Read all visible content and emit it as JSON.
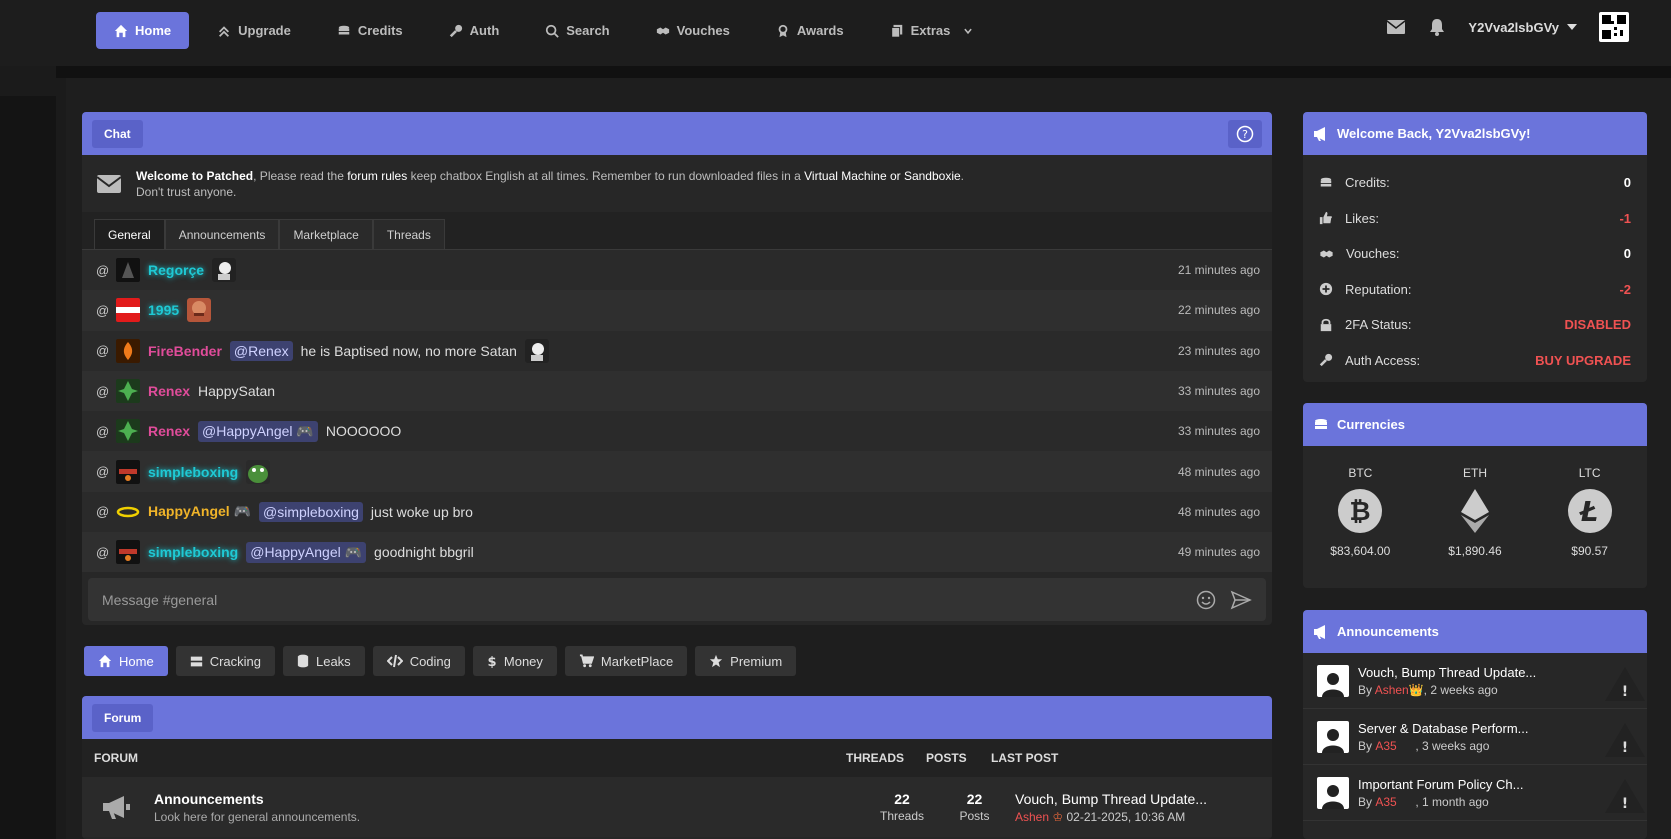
{
  "nav": {
    "items": [
      {
        "label": "Home",
        "icon": "home-icon"
      },
      {
        "label": "Upgrade",
        "icon": "upgrade-icon"
      },
      {
        "label": "Credits",
        "icon": "coins-icon"
      },
      {
        "label": "Auth",
        "icon": "key-icon"
      },
      {
        "label": "Search",
        "icon": "search-icon"
      },
      {
        "label": "Vouches",
        "icon": "handshake-icon"
      },
      {
        "label": "Awards",
        "icon": "award-icon"
      },
      {
        "label": "Extras",
        "icon": "copy-icon"
      }
    ],
    "username": "Y2Vva2lsbGVy"
  },
  "chat": {
    "title": "Chat",
    "notice_welcome": "Welcome to Patched",
    "notice_part1": ", Please read the ",
    "notice_rules": "forum rules",
    "notice_part2": " keep chatbox English at all times. Remember to run downloaded files in a ",
    "notice_vm": "Virtual Machine or Sandboxie",
    "notice_part3": ".",
    "notice_line2": "Don't trust anyone.",
    "tabs": [
      "General",
      "Announcements",
      "Marketplace",
      "Threads"
    ],
    "messages": [
      {
        "user": "Regorçe",
        "text": "",
        "mention": "",
        "time": "21 minutes ago"
      },
      {
        "user": "1995",
        "text": "",
        "mention": "",
        "time": "22 minutes ago"
      },
      {
        "user": "FireBender",
        "mention": "@Renex",
        "text": "he is Baptised now, no more Satan",
        "time": "23 minutes ago"
      },
      {
        "user": "Renex",
        "mention": "",
        "text": "HappySatan",
        "time": "33 minutes ago"
      },
      {
        "user": "Renex",
        "mention": "@HappyAngel 🎮",
        "text": "NOOOOOO",
        "time": "33 minutes ago"
      },
      {
        "user": "simpleboxing",
        "mention": "",
        "text": "",
        "time": "48 minutes ago"
      },
      {
        "user": "HappyAngel 🎮",
        "mention": "@simpleboxing",
        "text": "just woke up bro",
        "time": "48 minutes ago"
      },
      {
        "user": "simpleboxing",
        "mention": "@HappyAngel 🎮",
        "text": "goodnight bbgril",
        "time": "49 minutes ago"
      }
    ],
    "input_placeholder": "Message #general"
  },
  "categories": [
    "Home",
    "Cracking",
    "Leaks",
    "Coding",
    "Money",
    "MarketPlace",
    "Premium"
  ],
  "forum": {
    "title": "Forum",
    "columns": {
      "forum": "FORUM",
      "threads": "THREADS",
      "posts": "POSTS",
      "last_post": "LAST POST"
    },
    "rows": [
      {
        "title": "Announcements",
        "desc": "Look here for general announcements.",
        "threads": "22",
        "threads_label": "Threads",
        "posts": "22",
        "posts_label": "Posts",
        "last_title": "Vouch, Bump Thread Update...",
        "last_user": "Ashen",
        "last_date": "02-21-2025, 10:36 AM"
      }
    ]
  },
  "welcome": {
    "title": "Welcome Back, Y2Vva2lsbGVy!",
    "rows": [
      {
        "label": "Credits:",
        "value": "0"
      },
      {
        "label": "Likes:",
        "value": "-1"
      },
      {
        "label": "Vouches:",
        "value": "0"
      },
      {
        "label": "Reputation:",
        "value": "-2"
      },
      {
        "label": "2FA Status:",
        "value": "DISABLED"
      },
      {
        "label": "Auth Access:",
        "value": "BUY UPGRADE"
      }
    ]
  },
  "currencies": {
    "title": "Currencies",
    "items": [
      {
        "symbol": "BTC",
        "price": "$83,604.00"
      },
      {
        "symbol": "ETH",
        "price": "$1,890.46"
      },
      {
        "symbol": "LTC",
        "price": "$90.57"
      }
    ]
  },
  "announcements": {
    "title": "Announcements",
    "items": [
      {
        "title": "Vouch, Bump Thread Update...",
        "by": "By ",
        "author": "Ashen",
        "crown": "👑",
        "when": ", 2 weeks ago"
      },
      {
        "title": "Server & Database Perform...",
        "by": "By ",
        "author": "A35",
        "crown": "",
        "when": ", 3 weeks ago"
      },
      {
        "title": "Important Forum Policy Ch...",
        "by": "By ",
        "author": "A35",
        "crown": "",
        "when": ", 1 month ago"
      }
    ]
  },
  "colors": {
    "accent": "#6b74db",
    "danger": "#f05252",
    "teal": "#1fc9d4",
    "pink": "#e04c9a",
    "gold": "#f0b429"
  }
}
